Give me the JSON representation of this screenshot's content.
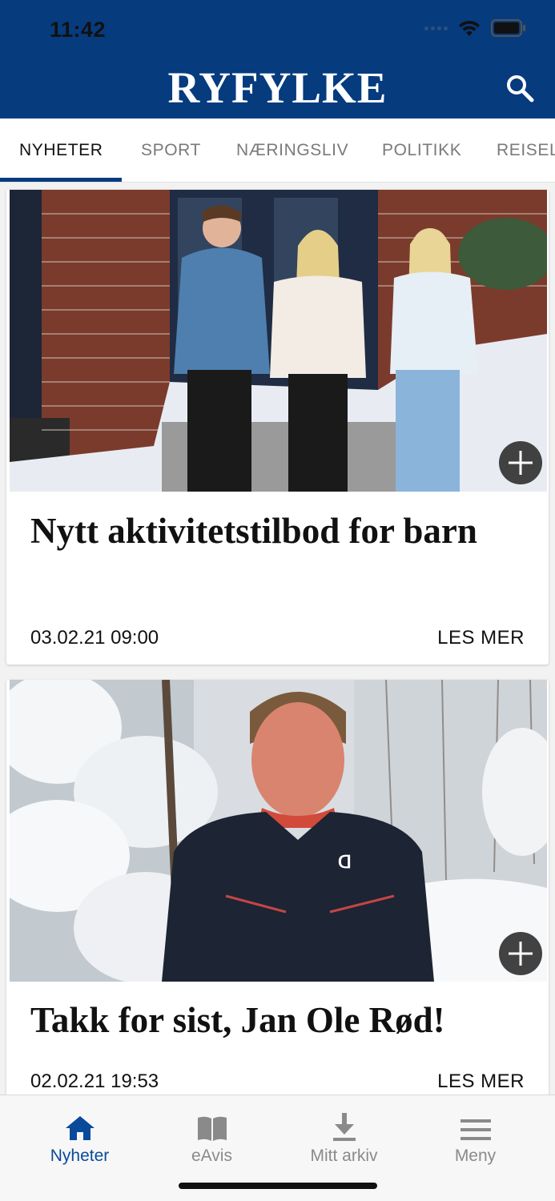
{
  "status_bar": {
    "time": "11:42"
  },
  "header": {
    "logo": "RYFYLKE",
    "brand_color": "#063b7e"
  },
  "tabs": [
    {
      "label": "NYHETER",
      "active": true
    },
    {
      "label": "SPORT",
      "active": false
    },
    {
      "label": "NÆRINGSLIV",
      "active": false
    },
    {
      "label": "POLITIKK",
      "active": false
    },
    {
      "label": "REISEL",
      "active": false
    }
  ],
  "articles": [
    {
      "headline": "Nytt aktivitetstilbod for barn",
      "date": "03.02.21 09:00",
      "read_more": "LES MER",
      "image": "three-teenagers-in-front-of-brick-school"
    },
    {
      "headline": "Takk for sist, Jan Ole Rød!",
      "date": "02.02.21 19:53",
      "read_more": "LES MER",
      "image": "man-in-snowy-forest"
    }
  ],
  "bottom_nav": [
    {
      "label": "Nyheter",
      "icon": "home-icon",
      "active": true
    },
    {
      "label": "eAvis",
      "icon": "book-icon",
      "active": false
    },
    {
      "label": "Mitt arkiv",
      "icon": "download-icon",
      "active": false
    },
    {
      "label": "Meny",
      "icon": "menu-icon",
      "active": false
    }
  ]
}
